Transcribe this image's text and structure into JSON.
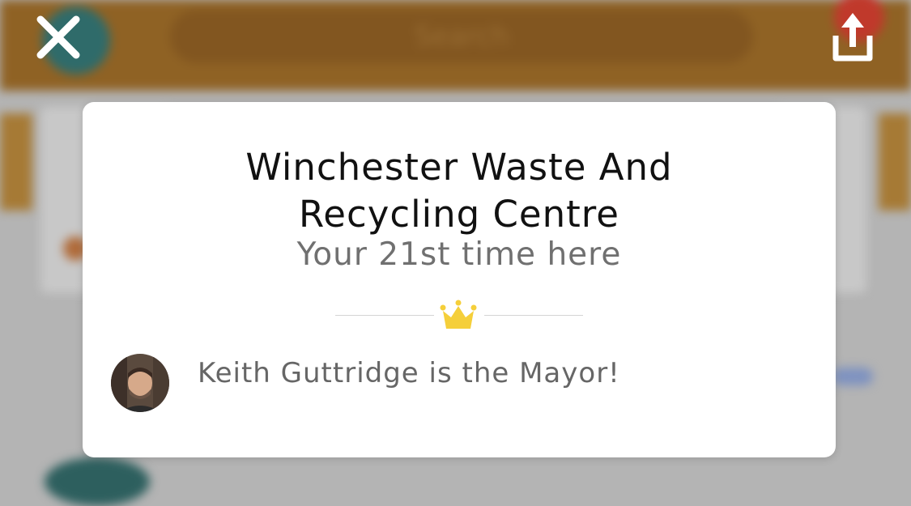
{
  "header": {
    "search_placeholder": "Search"
  },
  "actions": {
    "close_icon": "close-icon",
    "share_icon": "share-icon"
  },
  "modal": {
    "venue_name_line1": "Winchester Waste And",
    "venue_name_line2": "Recycling Centre",
    "visit_count": "Your 21st time here",
    "divider_icon": "crown-icon",
    "mayor_text": "Keith Guttridge is the Mayor!"
  },
  "colors": {
    "header_bg": "#8f6224",
    "crown": "#f5cf3a",
    "modal_bg": "#ffffff",
    "muted_text": "#707070"
  }
}
